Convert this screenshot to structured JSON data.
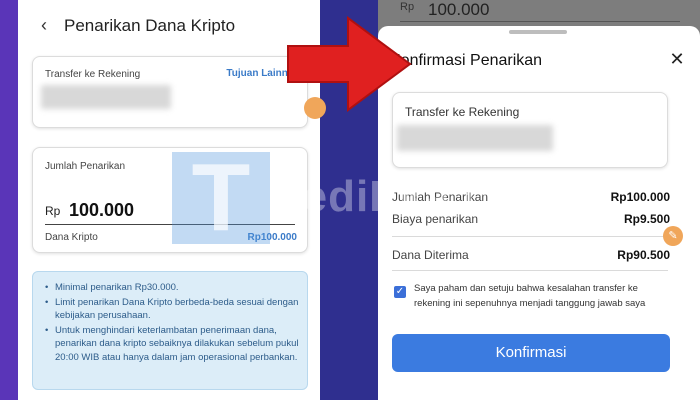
{
  "left": {
    "title": "Penarikan Dana Kripto",
    "transfer_label": "Transfer ke Rekening",
    "other_destination": "Tujuan Lainnya",
    "amount_label": "Jumlah Penarikan",
    "currency": "Rp",
    "amount": "100.000",
    "dana_kripto_label": "Dana Kripto",
    "dana_kripto_value": "Rp100.000",
    "info_items": [
      "Minimal penarikan Rp30.000.",
      "Limit penarikan Dana Kripto berbeda-beda sesuai dengan kebijakan perusahaan.",
      "Untuk menghindari keterlambatan penerimaan dana, penarikan dana kripto sebaiknya dilakukan sebelum pukul 20:00 WIB atau hanya dalam jam operasional perbankan."
    ]
  },
  "watermark": {
    "letter": "T",
    "text": "TediEka.com"
  },
  "right": {
    "top_label": "Rp",
    "top_value": "100.000",
    "sheet_title": "Konfirmasi Penarikan",
    "transfer_label": "Transfer ke Rekening",
    "rows": [
      {
        "label": "Jumlah Penarikan",
        "value": "Rp100.000"
      },
      {
        "label": "Biaya penarikan",
        "value": "Rp9.500"
      },
      {
        "label": "Dana Diterima",
        "value": "Rp90.500"
      }
    ],
    "agree_text": "Saya paham dan setuju bahwa kesalahan transfer ke rekening ini sepenuhnya menjadi tanggung jawab saya",
    "confirm_label": "Konfirmasi"
  },
  "colors": {
    "accent_blue": "#3b7be0",
    "link_blue": "#3b7bc8",
    "arrow_red": "#e02020",
    "phone_purple": "#5a35b8"
  },
  "icons": {
    "back": "back-arrow-icon",
    "close": "close-icon",
    "check": "checkbox-check-icon",
    "pencil": "pencil-icon"
  }
}
